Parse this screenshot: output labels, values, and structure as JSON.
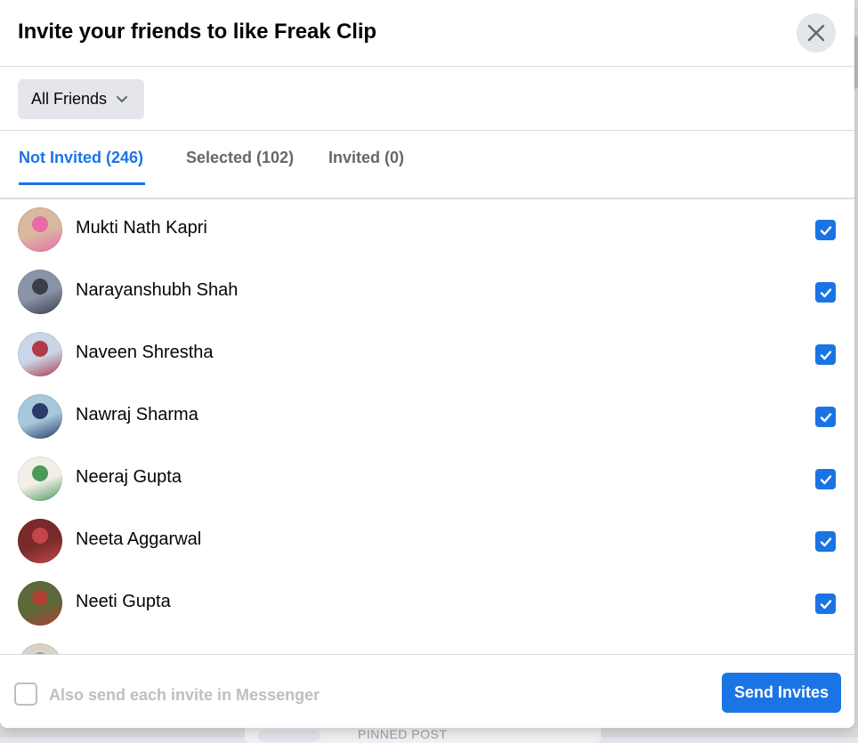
{
  "dialog": {
    "title": "Invite your friends to like Freak Clip",
    "close_icon": "close-icon"
  },
  "filter": {
    "label": "All Friends",
    "icon": "chevron-down-icon"
  },
  "tabs": [
    {
      "label": "Not Invited (246)",
      "active": true
    },
    {
      "label": "Selected (102)",
      "active": false
    },
    {
      "label": "Invited (0)",
      "active": false
    }
  ],
  "friends": [
    {
      "name": "Mukti Nath Kapri",
      "checked": true,
      "avatar_colors": [
        "#d9b8a0",
        "#e86aa8"
      ]
    },
    {
      "name": "Narayanshubh Shah",
      "checked": true,
      "avatar_colors": [
        "#8a94a8",
        "#3a3f4a"
      ]
    },
    {
      "name": "Naveen Shrestha",
      "checked": true,
      "avatar_colors": [
        "#c9d6e8",
        "#b03a4a"
      ]
    },
    {
      "name": "Nawraj Sharma",
      "checked": true,
      "avatar_colors": [
        "#a6c8dc",
        "#2a3a6a"
      ]
    },
    {
      "name": "Neeraj Gupta",
      "checked": true,
      "avatar_colors": [
        "#f2efe8",
        "#4a9a5a"
      ]
    },
    {
      "name": "Neeta Aggarwal",
      "checked": true,
      "avatar_colors": [
        "#7a2a2a",
        "#c4464a"
      ]
    },
    {
      "name": "Neeti Gupta",
      "checked": true,
      "avatar_colors": [
        "#5a6a3a",
        "#b04030"
      ]
    },
    {
      "name": "",
      "checked": false,
      "avatar_colors": [
        "#d8d2c8",
        "#a89888"
      ]
    }
  ],
  "footer": {
    "messenger_label": "Also send each invite in Messenger",
    "messenger_checked": false,
    "send_label": "Send Invites"
  },
  "backdrop": {
    "pinned_label": "PINNED POST"
  },
  "colors": {
    "accent": "#1b74e4",
    "muted_text": "#65676b",
    "button_gray": "#e4e6eb"
  }
}
